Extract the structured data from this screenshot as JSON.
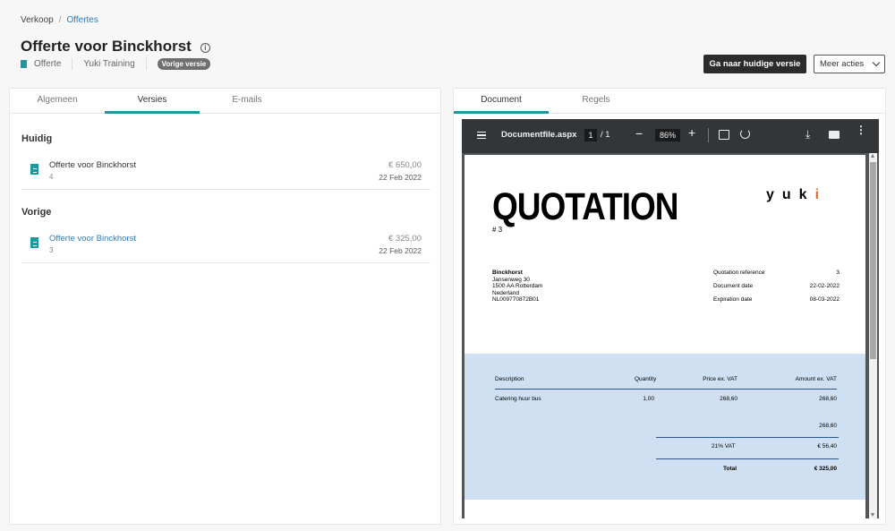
{
  "breadcrumb": {
    "root": "Verkoop",
    "current": "Offertes"
  },
  "page": {
    "title": "Offerte voor Binckhorst"
  },
  "meta": {
    "type": "Offerte",
    "company": "Yuki Training",
    "badge": "Vorige versie"
  },
  "actions": {
    "primary": "Ga naar huidige versie",
    "secondary": "Meer acties"
  },
  "left_tabs": [
    "Algemeen",
    "Versies",
    "E-mails"
  ],
  "right_tabs": [
    "Document",
    "Regels"
  ],
  "versions": {
    "current_title": "Huidig",
    "current": {
      "name": "Offerte voor Binckhorst",
      "number": "4",
      "amount": "€ 650,00",
      "date": "22 Feb 2022"
    },
    "previous_title": "Vorige",
    "previous": {
      "name": "Offerte voor Binckhorst",
      "number": "3",
      "amount": "€ 325,00",
      "date": "22 Feb 2022"
    }
  },
  "viewer": {
    "filename": "Documentfile.aspx",
    "page_current": "1",
    "page_total": "1",
    "zoom": "86%"
  },
  "document": {
    "title": "QUOTATION",
    "logo": "yuki",
    "number": "# 3",
    "address": [
      "Binckhorst",
      "Jansenweg 30",
      "1500 AA Rotterdam",
      "Nederland",
      "NL009770872B01"
    ],
    "refs": [
      {
        "label": "Quotation reference",
        "value": "3"
      },
      {
        "label": "Document date",
        "value": "22-02-2022"
      },
      {
        "label": "Expiration date",
        "value": "08-03-2022"
      }
    ],
    "table": {
      "headers": [
        "Description",
        "Quantity",
        "Price ex. VAT",
        "Amount ex. VAT"
      ],
      "rows": [
        {
          "description": "Catering huur bus",
          "quantity": "1,00",
          "price": "268,60",
          "amount": "268,60"
        }
      ],
      "subtotal": "268,60",
      "vat_label": "21% VAT",
      "vat_value": "€ 56,40",
      "total_label": "Total",
      "total_value": "€ 325,00"
    }
  }
}
